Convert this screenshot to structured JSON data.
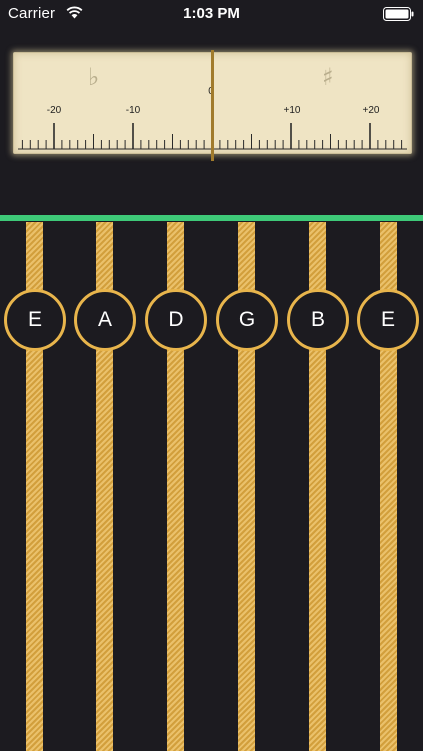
{
  "status_bar": {
    "carrier": "Carrier",
    "time": "1:03 PM"
  },
  "meter": {
    "flat_symbol": "♭",
    "sharp_symbol": "♯",
    "scale_labels": [
      "-20",
      "-10",
      "0",
      "+10",
      "+20"
    ],
    "needle_value": 0,
    "colors": {
      "face": "#efe4c4",
      "needle": "#a17b2c"
    }
  },
  "in_tune_indicator": {
    "color": "#3ec978"
  },
  "strings": [
    {
      "note": "E"
    },
    {
      "note": "A"
    },
    {
      "note": "D"
    },
    {
      "note": "G"
    },
    {
      "note": "B"
    },
    {
      "note": "E"
    }
  ],
  "colors": {
    "background": "#1c1b20",
    "string": "#e6b34a"
  }
}
